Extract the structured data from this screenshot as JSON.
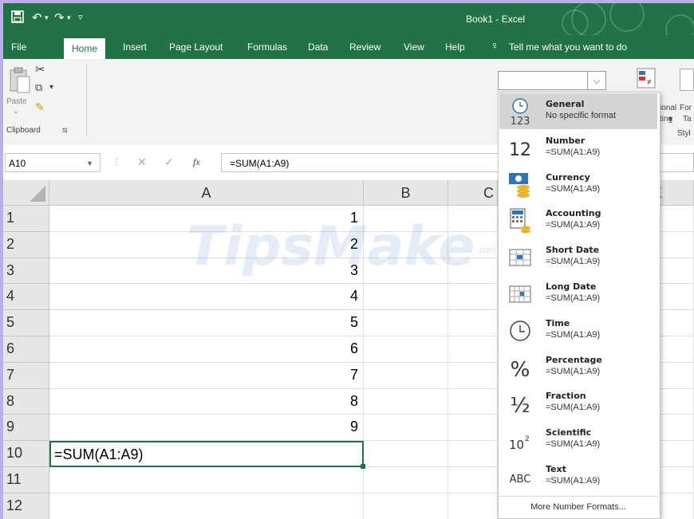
{
  "title_bar": {
    "title": "Book1 - Excel"
  },
  "tabs": [
    "File",
    "Home",
    "Insert",
    "Page Layout",
    "Formulas",
    "Data",
    "Review",
    "View",
    "Help"
  ],
  "tell_me": "Tell me what you want to do",
  "ribbon": {
    "paste_label": "Paste",
    "clipboard_group": "Clipboard",
    "cond_format_partial": "ional",
    "cond_format_partial2": "ting",
    "format_table_partial": "For",
    "format_table_partial2": "Ta",
    "styles_partial": "Styl"
  },
  "formula_bar": {
    "name_box": "A10",
    "formula": "=SUM(A1:A9)",
    "fx": "fx"
  },
  "columns": [
    "A",
    "B",
    "C",
    "E"
  ],
  "rows": [
    "1",
    "2",
    "3",
    "4",
    "5",
    "6",
    "7",
    "8",
    "9",
    "10",
    "11",
    "12"
  ],
  "cells_A": [
    "1",
    "2",
    "3",
    "4",
    "5",
    "6",
    "7",
    "8",
    "9",
    "=SUM(A1:A9)",
    "",
    ""
  ],
  "watermark": {
    "text": "TipsMake",
    "suffix": ".com"
  },
  "number_format_menu": {
    "items": [
      {
        "name": "General",
        "sample": "No specific format",
        "icon": "clock-123-icon"
      },
      {
        "name": "Number",
        "sample": "=SUM(A1:A9)",
        "icon": "number-12-icon"
      },
      {
        "name": "Currency",
        "sample": "=SUM(A1:A9)",
        "icon": "currency-icon"
      },
      {
        "name": "Accounting",
        "sample": "=SUM(A1:A9)",
        "icon": "accounting-icon"
      },
      {
        "name": "Short Date",
        "sample": "=SUM(A1:A9)",
        "icon": "short-date-icon"
      },
      {
        "name": "Long Date",
        "sample": "=SUM(A1:A9)",
        "icon": "long-date-icon"
      },
      {
        "name": "Time",
        "sample": "=SUM(A1:A9)",
        "icon": "clock-icon"
      },
      {
        "name": "Percentage",
        "sample": "=SUM(A1:A9)",
        "icon": "percent-icon"
      },
      {
        "name": "Fraction",
        "sample": "=SUM(A1:A9)",
        "icon": "fraction-icon"
      },
      {
        "name": "Scientific",
        "sample": "=SUM(A1:A9)",
        "icon": "scientific-icon"
      },
      {
        "name": "Text",
        "sample": "=SUM(A1:A9)",
        "icon": "abc-icon"
      }
    ],
    "more": "More Number Formats..."
  },
  "colors": {
    "excel_green": "#217346",
    "frame": "#b9aee6"
  }
}
